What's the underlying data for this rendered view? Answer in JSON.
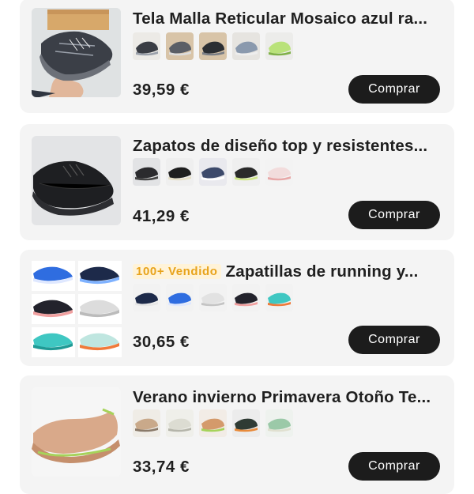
{
  "products": [
    {
      "title": "Tela Malla Reticular Mosaico azul ra...",
      "badge": "",
      "price": "39,59 €",
      "buy_label": "Comprar",
      "thumb_colors": [
        "#3a3d44",
        "#5a5e66",
        "#2b2e33",
        "#8a99ad",
        "#b9e27a"
      ]
    },
    {
      "title": "Zapatos de diseño top y resistentes...",
      "badge": "",
      "price": "41,29 €",
      "buy_label": "Comprar",
      "thumb_colors": [
        "#2b2b2e",
        "#1f1f1f",
        "#3d4a6b",
        "#2a2a2a",
        "#f2dcdc"
      ]
    },
    {
      "title": "Zapatillas de running y...",
      "badge": "100+ Vendido",
      "price": "30,65 €",
      "buy_label": "Comprar",
      "thumb_colors": [
        "#1d2a4a",
        "#2f6de0",
        "#e2e2e2",
        "#23232c",
        "#3fc7c2"
      ]
    },
    {
      "title": "Verano invierno Primavera Otoño Te...",
      "badge": "",
      "price": "33,74 €",
      "buy_label": "Comprar",
      "thumb_colors": [
        "#c9a98a",
        "#dcdcd2",
        "#d49a6b",
        "#2f3b34",
        "#9bc9a8"
      ]
    }
  ]
}
